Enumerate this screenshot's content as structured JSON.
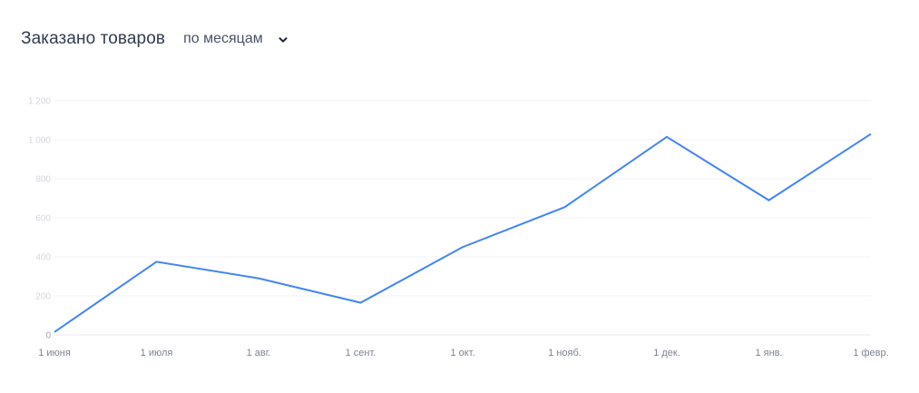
{
  "header": {
    "title": "Заказано товаров",
    "period_label": "по месяцам",
    "chevron_icon": "chevron-down-icon"
  },
  "chart_data": {
    "type": "line",
    "title": "Заказано товаров",
    "xlabel": "",
    "ylabel": "",
    "ylim": [
      0,
      1200
    ],
    "y_ticks": [
      0,
      200,
      400,
      600,
      800,
      1000,
      1200
    ],
    "y_tick_labels": [
      "0",
      "200",
      "400",
      "600",
      "800",
      "1 000",
      "1 200"
    ],
    "categories": [
      "1 июня",
      "1 июля",
      "1 авг.",
      "1 сент.",
      "1 окт.",
      "1 нояб.",
      "1 дек.",
      "1 янв.",
      "1 февр."
    ],
    "series": [
      {
        "name": "",
        "color": "#4285f4",
        "values": [
          15,
          375,
          290,
          165,
          450,
          655,
          1015,
          690,
          1030
        ]
      }
    ],
    "grid": true,
    "legend": "none"
  }
}
